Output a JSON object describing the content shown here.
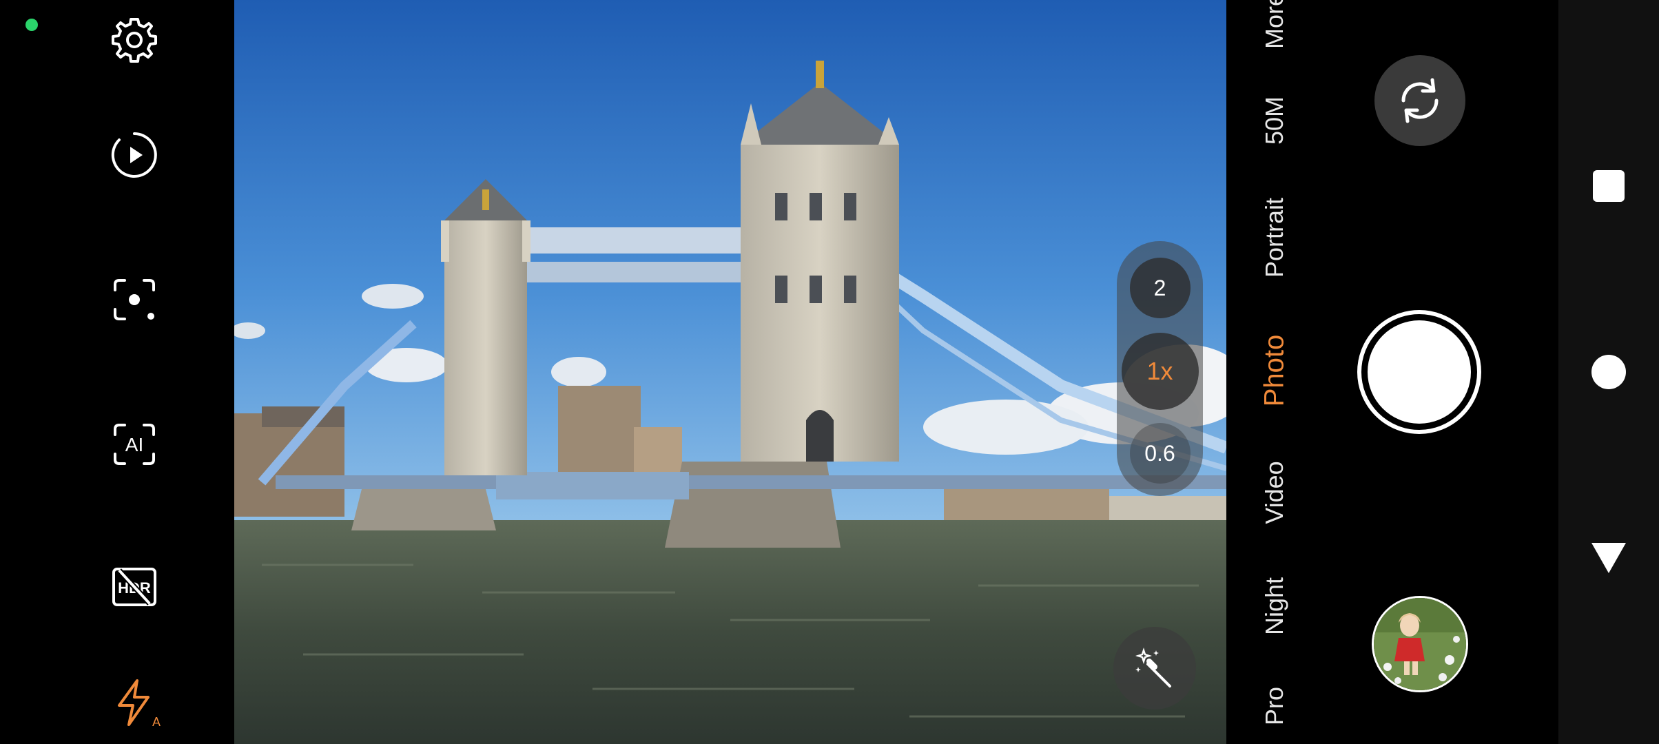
{
  "status": {
    "indicator_color": "#2bd46b"
  },
  "left_toolbar": {
    "icons": [
      "gear-icon",
      "timer-icon",
      "scene-detect-icon",
      "ai-icon",
      "hdr-off-icon",
      "flash-auto-icon"
    ],
    "ai_label": "AI",
    "hdr_label": "HDR",
    "flash_mode": "A",
    "accent_color": "#f08a3a"
  },
  "viewfinder": {
    "zoom": {
      "options": [
        "2",
        "1x",
        "0.6"
      ],
      "selected": "1x"
    },
    "magic_icon": "magic-wand-icon"
  },
  "modes": {
    "items": [
      "Pro",
      "Night",
      "Video",
      "Photo",
      "Portrait",
      "50M",
      "More"
    ],
    "active": "Photo"
  },
  "capture": {
    "flip_icon": "camera-flip-icon",
    "shutter_icon": "shutter-button",
    "gallery_icon": "gallery-thumbnail"
  },
  "system_nav": {
    "icons": [
      "recents-square-icon",
      "home-circle-icon",
      "back-triangle-icon"
    ]
  }
}
